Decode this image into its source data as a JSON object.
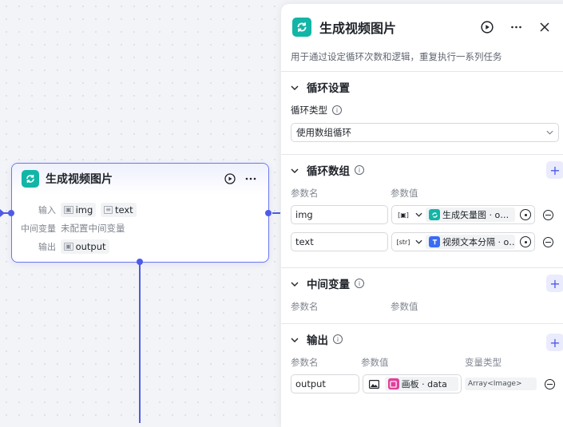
{
  "node": {
    "title": "生成视频图片",
    "input_label": "输入",
    "inputs": [
      "img",
      "text"
    ],
    "mid_label": "中间变量",
    "mid_value": "未配置中间变量",
    "output_label": "输出",
    "outputs": [
      "output"
    ]
  },
  "panel": {
    "title": "生成视频图片",
    "description": "用于通过设定循环次数和逻辑，重复执行一系列任务",
    "loop_settings": {
      "title": "循环设置",
      "type_label": "循环类型",
      "type_value": "使用数组循环"
    },
    "loop_array": {
      "title": "循环数组",
      "col_name": "参数名",
      "col_value": "参数值",
      "rows": [
        {
          "name": "img",
          "type_glyph": "[▣]",
          "ref": "生成矢量图 · o…"
        },
        {
          "name": "text",
          "type_glyph": "[str]",
          "ref": "视频文本分隔 · o…"
        }
      ]
    },
    "mid_vars": {
      "title": "中间变量",
      "col_name": "参数名",
      "col_value": "参数值"
    },
    "output": {
      "title": "输出",
      "col_name": "参数名",
      "col_value": "参数值",
      "col_type": "变量类型",
      "rows": [
        {
          "name": "output",
          "ref": "画板 · data",
          "type": "Array<Image>"
        }
      ]
    }
  },
  "colors": {
    "accent": "#4e5ae8",
    "loop_icon": "#12b5a6",
    "vector_ref": "#12b5a6",
    "text_ref": "#3a6cf4",
    "board_ref": "#e0409a"
  }
}
